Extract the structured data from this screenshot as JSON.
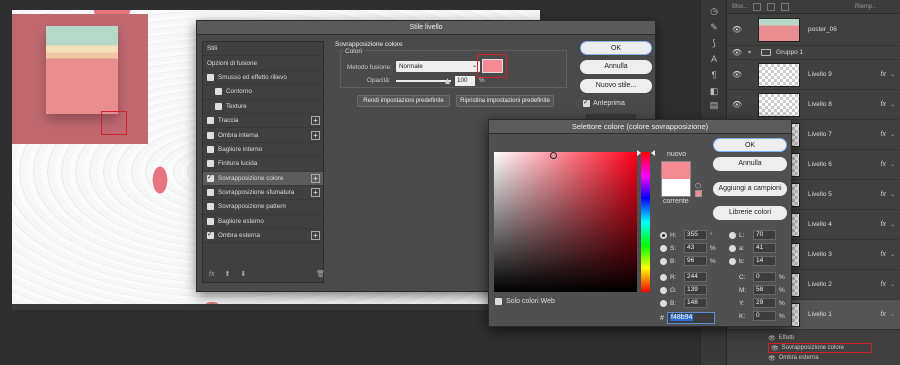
{
  "canvas": {
    "accent_color": "#e8767e",
    "poster_colors": [
      "#b6d8c9",
      "#f4e0b8",
      "#f0c7a2",
      "#e88e90"
    ]
  },
  "layers_panel": {
    "top_label_left": "Bloc.:",
    "top_label_right": "Riemp.:",
    "rows": [
      {
        "name": "poster_06",
        "fx": ""
      },
      {
        "name": "Livello 9",
        "fx": "fx"
      },
      {
        "name": "Livello 8",
        "fx": "fx"
      },
      {
        "name": "Livello 7",
        "fx": "fx"
      },
      {
        "name": "Livello 6",
        "fx": "fx"
      },
      {
        "name": "Livello 5",
        "fx": "fx"
      },
      {
        "name": "Livello 4",
        "fx": "fx"
      },
      {
        "name": "Livello 3",
        "fx": "fx"
      },
      {
        "name": "Livello 2",
        "fx": "fx"
      },
      {
        "name": "Livello 1",
        "fx": "fx"
      }
    ],
    "group_name": "Gruppo 1",
    "effects_label": "Effetti",
    "effect_items": [
      "Sovrapposizione colore",
      "Ombra esterna"
    ]
  },
  "stile_livello": {
    "title": "Stile livello",
    "styles": [
      {
        "label": "Stili",
        "checkbox": false,
        "checked": false,
        "plus": false,
        "sub": false
      },
      {
        "label": "Opzioni di fusione",
        "checkbox": false,
        "checked": false,
        "plus": false,
        "sub": false
      },
      {
        "label": "Smusso ed effetto rilievo",
        "checkbox": true,
        "checked": false,
        "plus": false,
        "sub": false
      },
      {
        "label": "Contorno",
        "checkbox": true,
        "checked": false,
        "plus": false,
        "sub": true
      },
      {
        "label": "Texture",
        "checkbox": true,
        "checked": false,
        "plus": false,
        "sub": true
      },
      {
        "label": "Traccia",
        "checkbox": true,
        "checked": false,
        "plus": true,
        "sub": false
      },
      {
        "label": "Ombra interna",
        "checkbox": true,
        "checked": false,
        "plus": true,
        "sub": false
      },
      {
        "label": "Bagliore interno",
        "checkbox": true,
        "checked": false,
        "plus": false,
        "sub": false
      },
      {
        "label": "Finitura lucida",
        "checkbox": true,
        "checked": false,
        "plus": false,
        "sub": false
      },
      {
        "label": "Sovrapposizione colore",
        "checkbox": true,
        "checked": true,
        "plus": true,
        "sub": false,
        "selected": true
      },
      {
        "label": "Sovrapposizione sfumatura",
        "checkbox": true,
        "checked": false,
        "plus": true,
        "sub": false
      },
      {
        "label": "Sovrapposizione pattern",
        "checkbox": true,
        "checked": false,
        "plus": false,
        "sub": false
      },
      {
        "label": "Bagliore esterno",
        "checkbox": true,
        "checked": false,
        "plus": false,
        "sub": false
      },
      {
        "label": "Ombra esterna",
        "checkbox": true,
        "checked": true,
        "plus": true,
        "sub": false
      }
    ],
    "footer_fx": "fx",
    "section_title": "Sovrapposizione colore",
    "group_title": "Colori",
    "metodo_label": "Metodo fusione:",
    "metodo_value": "Normale",
    "overlay_color": "#f48b94",
    "opacity_label": "Opacità:",
    "opacity_value": "100",
    "opacity_unit": "%",
    "btn_rendi": "Rendi impostazioni predefinite",
    "btn_ripristina": "Ripristina impostazioni predefinite",
    "btn_ok": "OK",
    "btn_annulla": "Annulla",
    "btn_nuovo": "Nuovo stile...",
    "anteprima_label": "Anteprima",
    "anteprima_checked": true
  },
  "selettore_colore": {
    "title": "Selettore colore (colore sovrapposizione)",
    "nuovo_label": "nuovo",
    "corrente_label": "corrente",
    "new_color": "#f48b94",
    "current_color": "#ffffff",
    "btn_ok": "OK",
    "btn_annulla": "Annulla",
    "btn_aggiungi": "Aggiungi a campioni",
    "btn_librerie": "Librerie colori",
    "web_only_label": "Solo colori Web",
    "hsb": [
      {
        "label": "H:",
        "value": "355",
        "unit": "°",
        "selected": true
      },
      {
        "label": "S:",
        "value": "43",
        "unit": "%",
        "selected": false
      },
      {
        "label": "B:",
        "value": "96",
        "unit": "%",
        "selected": false
      }
    ],
    "rgb": [
      {
        "label": "R:",
        "value": "244"
      },
      {
        "label": "G:",
        "value": "139"
      },
      {
        "label": "B:",
        "value": "148"
      }
    ],
    "lab": [
      {
        "label": "L:",
        "value": "70"
      },
      {
        "label": "a:",
        "value": "41"
      },
      {
        "label": "b:",
        "value": "14"
      }
    ],
    "cmyk": [
      {
        "label": "C:",
        "value": "0",
        "unit": "%"
      },
      {
        "label": "M:",
        "value": "58",
        "unit": "%"
      },
      {
        "label": "Y:",
        "value": "29",
        "unit": "%"
      },
      {
        "label": "K:",
        "value": "0",
        "unit": "%"
      }
    ],
    "hex_label": "#",
    "hex_value": "f48b94"
  }
}
